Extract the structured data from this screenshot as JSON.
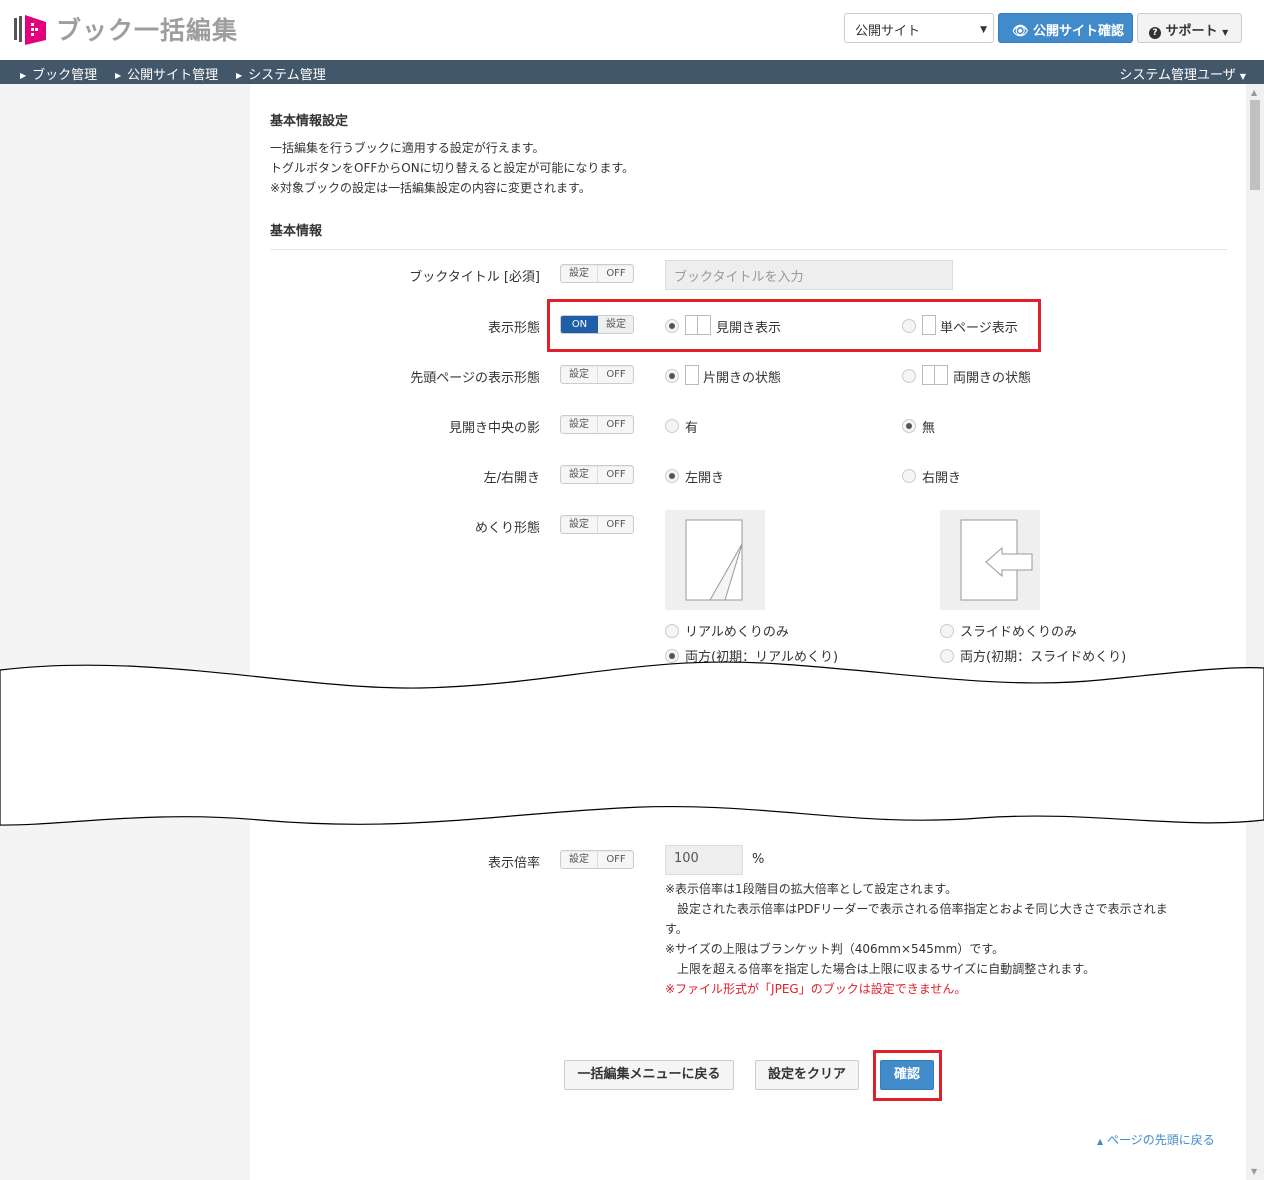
{
  "header": {
    "app_title": "ブック一括編集",
    "site_select_value": "公開サイト",
    "preview_button": "公開サイト確認",
    "support_button": "サポート"
  },
  "nav": {
    "items": [
      {
        "label": "ブック管理"
      },
      {
        "label": "公開サイト管理"
      },
      {
        "label": "システム管理"
      }
    ],
    "user": "システム管理ユーザ"
  },
  "content": {
    "section_title": "基本情報設定",
    "description": [
      "一括編集を行うブックに適用する設定が行えます。",
      "トグルボタンをOFFからONに切り替えると設定が可能になります。",
      "※対象ブックの設定は一括編集設定の内容に変更されます。"
    ],
    "subsection_title": "基本情報",
    "toggle": {
      "setting": "設定",
      "off": "OFF",
      "on": "ON"
    },
    "rows": {
      "book_title": {
        "label": "ブックタイトル [必須]",
        "placeholder": "ブックタイトルを入力"
      },
      "display_mode": {
        "label": "表示形態",
        "opt1": "見開き表示",
        "opt2": "単ページ表示",
        "selected": 1
      },
      "first_page": {
        "label": "先頭ページの表示形態",
        "opt1": "片開きの状態",
        "opt2": "両開きの状態",
        "selected": 1
      },
      "spine_shadow": {
        "label": "見開き中央の影",
        "opt1": "有",
        "opt2": "無",
        "selected": 2
      },
      "binding": {
        "label": "左/右開き",
        "opt1": "左開き",
        "opt2": "右開き",
        "selected": 1
      },
      "flip": {
        "label": "めくり形態",
        "opt1": "リアルめくりのみ",
        "opt2": "スライドめくりのみ",
        "opt3": "両方(初期：リアルめくり)",
        "opt4": "両方(初期：スライドめくり)",
        "selected": 3
      },
      "zoom": {
        "label": "表示倍率",
        "value": "100",
        "unit": "%",
        "notes": [
          "※表示倍率は1段階目の拡大倍率として設定されます。",
          "　設定された表示倍率はPDFリーダーで表示される倍率指定とおよそ同じ大きさで表示されま",
          "す。",
          "※サイズの上限はブランケット判（406mm×545mm）です。",
          "　上限を超える倍率を指定した場合は上限に収まるサイズに自動調整されます。"
        ],
        "warning": "※ファイル形式が「JPEG」のブックは設定できません。"
      }
    },
    "buttons": {
      "back": "一括編集メニューに戻る",
      "clear": "設定をクリア",
      "confirm": "確認"
    },
    "back_to_top": "ページの先頭に戻る"
  },
  "colors": {
    "accent": "#428bca",
    "nav_bg": "#43576b",
    "highlight": "#e0202a",
    "toggle_on": "#1f5fa8"
  }
}
